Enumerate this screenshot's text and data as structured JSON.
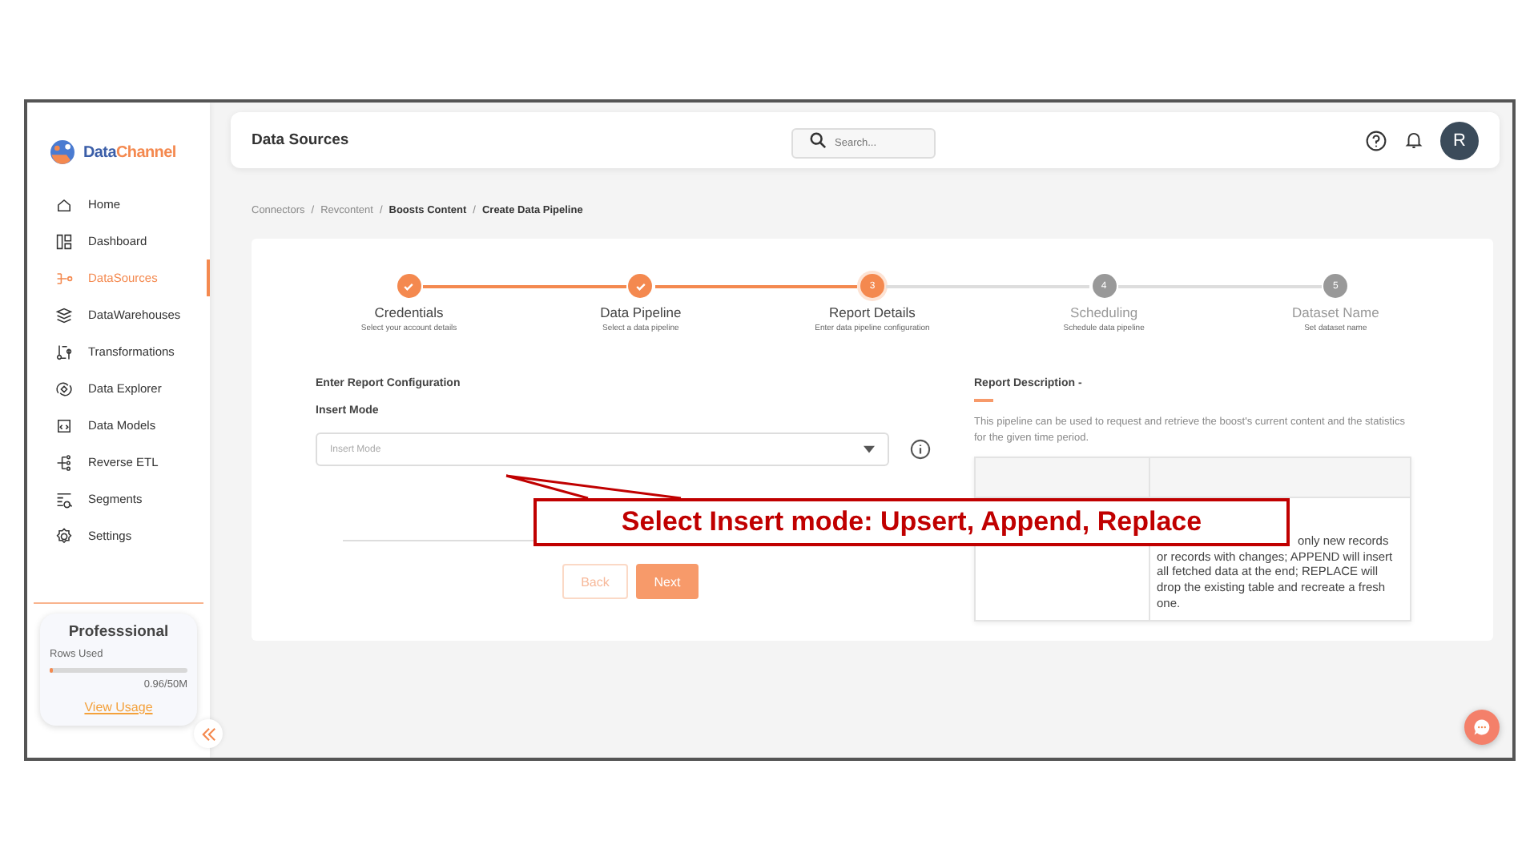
{
  "brand": {
    "name_parts": [
      "Data",
      "Channel"
    ]
  },
  "sidebar": {
    "items": [
      {
        "label": "Home",
        "selected": false
      },
      {
        "label": "Dashboard",
        "selected": false
      },
      {
        "label": "DataSources",
        "selected": true
      },
      {
        "label": "DataWarehouses",
        "selected": false
      },
      {
        "label": "Transformations",
        "selected": false
      },
      {
        "label": "Data Explorer",
        "selected": false
      },
      {
        "label": "Data Models",
        "selected": false
      },
      {
        "label": "Reverse ETL",
        "selected": false
      },
      {
        "label": "Segments",
        "selected": false
      },
      {
        "label": "Settings",
        "selected": false
      }
    ]
  },
  "plan": {
    "title": "Professsional",
    "rows_label": "Rows Used",
    "level": 0.02,
    "reading": "0.96/50M",
    "link": "View Usage"
  },
  "header": {
    "title": "Data Sources",
    "search": {
      "placeholder": "Search..."
    },
    "avatar": "R"
  },
  "breadcrumb_separator": "/",
  "breadcrumb": [
    {
      "label": "Connectors",
      "current": false
    },
    {
      "label": "Revcontent",
      "current": false
    },
    {
      "label": "Boosts Content",
      "current": true
    },
    {
      "label": "Create Data Pipeline",
      "current": true
    }
  ],
  "steps": [
    {
      "label": "Credentials",
      "sublabel": "Select your account details",
      "completed": true,
      "selected": false
    },
    {
      "label": "Data Pipeline",
      "sublabel": "Select a data pipeline",
      "completed": true,
      "selected": false
    },
    {
      "number": "3",
      "label": "Report Details",
      "sublabel": "Enter data pipeline configuration",
      "completed": false,
      "selected": true
    },
    {
      "number": "4",
      "label": "Scheduling",
      "sublabel": "Schedule data pipeline",
      "completed": false,
      "selected": false
    },
    {
      "number": "5",
      "label": "Dataset Name",
      "sublabel": "Set dataset name",
      "completed": false,
      "selected": false
    }
  ],
  "form": {
    "section_title": "Enter Report Configuration",
    "field_label": "Insert Mode",
    "placeholder": "Insert Mode",
    "buttons": [
      "Back",
      "Next"
    ]
  },
  "description": {
    "title": "Report Description -",
    "text": "This pipeline can be used to request and retrieve the boost's current content and the statistics for the given time period.",
    "table_text": "only new records or records with changes; APPEND will insert all fetched data at the end; REPLACE will drop the existing table and recreate a fresh one."
  },
  "annotation": {
    "text": "Select Insert mode: Upsert, Append, Replace"
  }
}
